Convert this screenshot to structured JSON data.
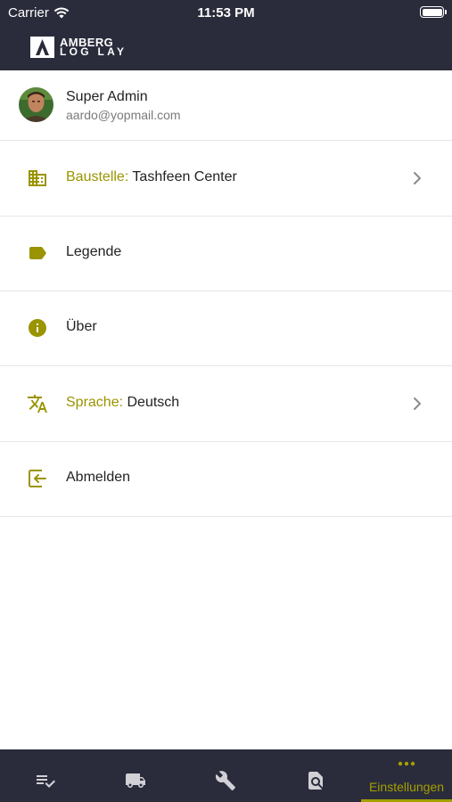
{
  "status_bar": {
    "carrier": "Carrier",
    "time": "11:53 PM"
  },
  "app": {
    "logo_line1": "AMBERG",
    "logo_line2": "LOG LAY"
  },
  "profile": {
    "name": "Super Admin",
    "email": "aardo@yopmail.com"
  },
  "menu": {
    "site_key": "Baustelle:",
    "site_value": "Tashfeen Center",
    "legend": "Legende",
    "about": "Über",
    "language_key": "Sprache:",
    "language_value": "Deutsch",
    "logout": "Abmelden"
  },
  "tabbar": {
    "active_label": "Einstellungen"
  },
  "colors": {
    "accent": "#9a9400",
    "header_bg": "#2a2c3b"
  },
  "icons": {
    "site": "building-icon",
    "legend": "tag-icon",
    "about": "info-icon",
    "language": "translate-icon",
    "logout": "logout-icon",
    "tabs": [
      "checklist-icon",
      "truck-icon",
      "wrench-icon",
      "document-search-icon",
      "more-icon"
    ]
  }
}
